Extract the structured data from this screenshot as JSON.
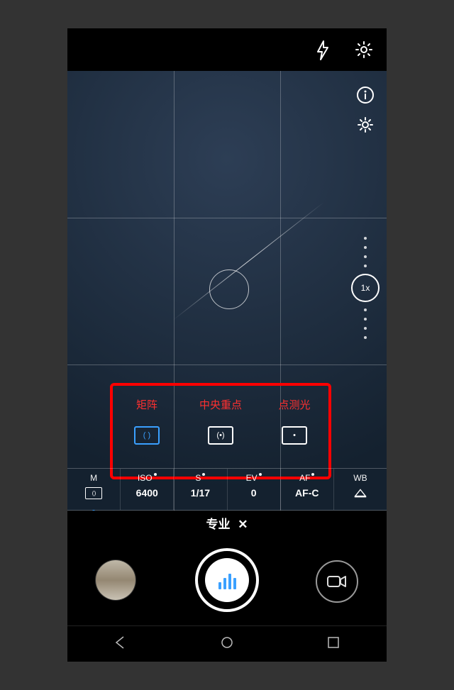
{
  "top": {
    "flash_icon": "flash",
    "settings_icon": "settings"
  },
  "overlay": {
    "info_icon": "info",
    "brightness_icon": "brightness",
    "zoom_label": "1x"
  },
  "metering": {
    "options": [
      {
        "label": "矩阵",
        "icon_inner": "( )",
        "active": true
      },
      {
        "label": "中央重点",
        "icon_inner": "(•)",
        "active": false
      },
      {
        "label": "点测光",
        "icon_inner": "•",
        "active": false
      }
    ]
  },
  "params": [
    {
      "label": "M",
      "value": "",
      "value_is_icon": true,
      "icon_inner": "( )",
      "modified": false,
      "active": true
    },
    {
      "label": "ISO",
      "value": "6400",
      "value_is_icon": false,
      "modified": true,
      "active": false
    },
    {
      "label": "S",
      "value": "1/17",
      "value_is_icon": false,
      "modified": true,
      "active": false
    },
    {
      "label": "EV",
      "value": "0",
      "value_is_icon": false,
      "modified": true,
      "active": false
    },
    {
      "label": "AF",
      "value": "AF-C",
      "value_is_icon": false,
      "modified": true,
      "active": false
    },
    {
      "label": "WB",
      "value": "",
      "value_is_icon": true,
      "icon_is_wb": true,
      "modified": false,
      "active": false
    }
  ],
  "mode": {
    "name": "专业",
    "close": "✕"
  },
  "shutter": {
    "bars": [
      10,
      16,
      22,
      16
    ]
  },
  "nav": {
    "back": "back",
    "home": "home",
    "recent": "recent"
  }
}
